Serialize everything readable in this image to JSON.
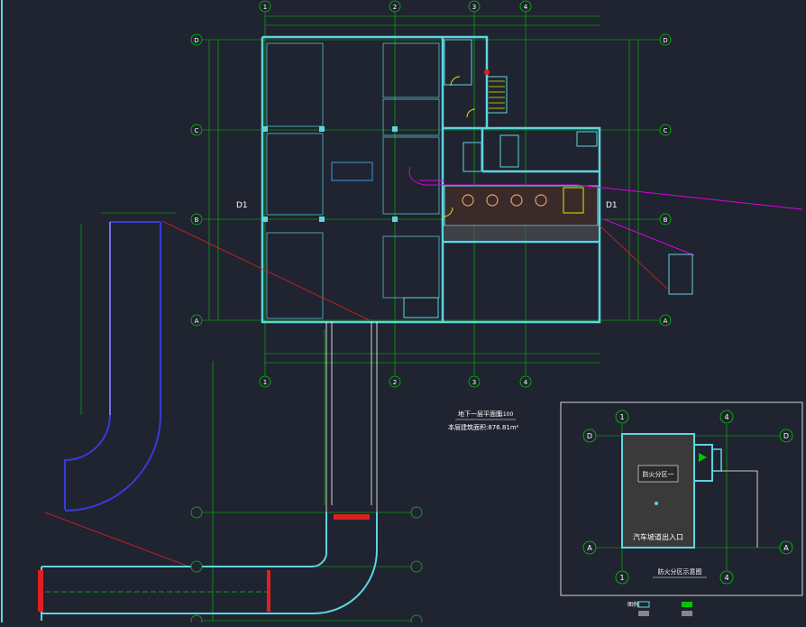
{
  "colors": {
    "background": "#1f2430",
    "wall": "#5fd4e0",
    "grid": "#00c800",
    "dim": "#00c800",
    "magenta": "#e000e0",
    "blue": "#3a3ad8",
    "red": "#e02020",
    "white": "#ffffff",
    "yellow": "#e8e800"
  },
  "axes": {
    "top": [
      "1",
      "2",
      "3",
      "4"
    ],
    "left": [
      "D",
      "C",
      "B",
      "A"
    ],
    "right": [
      "D",
      "C",
      "B",
      "A"
    ],
    "bottom": [
      "1",
      "2",
      "3",
      "4"
    ]
  },
  "zone_labels": {
    "d1_left": "D1",
    "d1_right": "D1"
  },
  "plan_title": {
    "title": "地下一层平面图",
    "scale": "1:100",
    "area": "本层建筑面积:876.81m²"
  },
  "inset": {
    "caption": "防火分区示意图",
    "zone_name": "防火分区一",
    "entrance": "汽车坡道出入口",
    "axes_top": [
      "1",
      "4"
    ],
    "axes_bottom": [
      "1",
      "4"
    ],
    "axes_side": [
      "D",
      "A"
    ]
  },
  "legend": {
    "heading": "图例:"
  }
}
